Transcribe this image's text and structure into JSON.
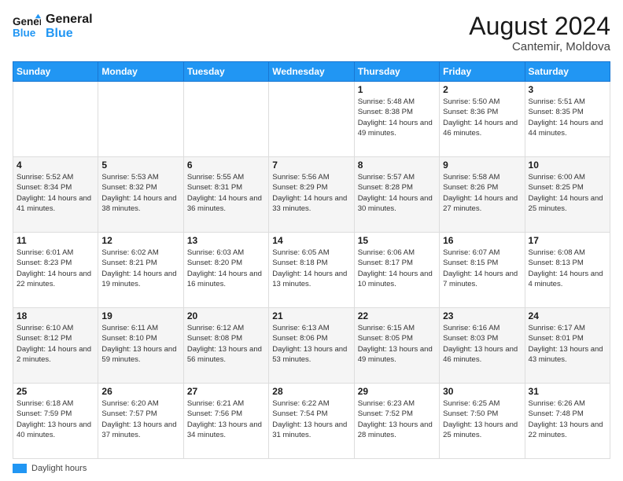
{
  "header": {
    "logo_line1": "General",
    "logo_line2": "Blue",
    "main_title": "August 2024",
    "subtitle": "Cantemir, Moldova"
  },
  "legend": {
    "label": "Daylight hours"
  },
  "days_of_week": [
    "Sunday",
    "Monday",
    "Tuesday",
    "Wednesday",
    "Thursday",
    "Friday",
    "Saturday"
  ],
  "weeks": [
    [
      {
        "day": "",
        "info": ""
      },
      {
        "day": "",
        "info": ""
      },
      {
        "day": "",
        "info": ""
      },
      {
        "day": "",
        "info": ""
      },
      {
        "day": "1",
        "info": "Sunrise: 5:48 AM\nSunset: 8:38 PM\nDaylight: 14 hours\nand 49 minutes."
      },
      {
        "day": "2",
        "info": "Sunrise: 5:50 AM\nSunset: 8:36 PM\nDaylight: 14 hours\nand 46 minutes."
      },
      {
        "day": "3",
        "info": "Sunrise: 5:51 AM\nSunset: 8:35 PM\nDaylight: 14 hours\nand 44 minutes."
      }
    ],
    [
      {
        "day": "4",
        "info": "Sunrise: 5:52 AM\nSunset: 8:34 PM\nDaylight: 14 hours\nand 41 minutes."
      },
      {
        "day": "5",
        "info": "Sunrise: 5:53 AM\nSunset: 8:32 PM\nDaylight: 14 hours\nand 38 minutes."
      },
      {
        "day": "6",
        "info": "Sunrise: 5:55 AM\nSunset: 8:31 PM\nDaylight: 14 hours\nand 36 minutes."
      },
      {
        "day": "7",
        "info": "Sunrise: 5:56 AM\nSunset: 8:29 PM\nDaylight: 14 hours\nand 33 minutes."
      },
      {
        "day": "8",
        "info": "Sunrise: 5:57 AM\nSunset: 8:28 PM\nDaylight: 14 hours\nand 30 minutes."
      },
      {
        "day": "9",
        "info": "Sunrise: 5:58 AM\nSunset: 8:26 PM\nDaylight: 14 hours\nand 27 minutes."
      },
      {
        "day": "10",
        "info": "Sunrise: 6:00 AM\nSunset: 8:25 PM\nDaylight: 14 hours\nand 25 minutes."
      }
    ],
    [
      {
        "day": "11",
        "info": "Sunrise: 6:01 AM\nSunset: 8:23 PM\nDaylight: 14 hours\nand 22 minutes."
      },
      {
        "day": "12",
        "info": "Sunrise: 6:02 AM\nSunset: 8:21 PM\nDaylight: 14 hours\nand 19 minutes."
      },
      {
        "day": "13",
        "info": "Sunrise: 6:03 AM\nSunset: 8:20 PM\nDaylight: 14 hours\nand 16 minutes."
      },
      {
        "day": "14",
        "info": "Sunrise: 6:05 AM\nSunset: 8:18 PM\nDaylight: 14 hours\nand 13 minutes."
      },
      {
        "day": "15",
        "info": "Sunrise: 6:06 AM\nSunset: 8:17 PM\nDaylight: 14 hours\nand 10 minutes."
      },
      {
        "day": "16",
        "info": "Sunrise: 6:07 AM\nSunset: 8:15 PM\nDaylight: 14 hours\nand 7 minutes."
      },
      {
        "day": "17",
        "info": "Sunrise: 6:08 AM\nSunset: 8:13 PM\nDaylight: 14 hours\nand 4 minutes."
      }
    ],
    [
      {
        "day": "18",
        "info": "Sunrise: 6:10 AM\nSunset: 8:12 PM\nDaylight: 14 hours\nand 2 minutes."
      },
      {
        "day": "19",
        "info": "Sunrise: 6:11 AM\nSunset: 8:10 PM\nDaylight: 13 hours\nand 59 minutes."
      },
      {
        "day": "20",
        "info": "Sunrise: 6:12 AM\nSunset: 8:08 PM\nDaylight: 13 hours\nand 56 minutes."
      },
      {
        "day": "21",
        "info": "Sunrise: 6:13 AM\nSunset: 8:06 PM\nDaylight: 13 hours\nand 53 minutes."
      },
      {
        "day": "22",
        "info": "Sunrise: 6:15 AM\nSunset: 8:05 PM\nDaylight: 13 hours\nand 49 minutes."
      },
      {
        "day": "23",
        "info": "Sunrise: 6:16 AM\nSunset: 8:03 PM\nDaylight: 13 hours\nand 46 minutes."
      },
      {
        "day": "24",
        "info": "Sunrise: 6:17 AM\nSunset: 8:01 PM\nDaylight: 13 hours\nand 43 minutes."
      }
    ],
    [
      {
        "day": "25",
        "info": "Sunrise: 6:18 AM\nSunset: 7:59 PM\nDaylight: 13 hours\nand 40 minutes."
      },
      {
        "day": "26",
        "info": "Sunrise: 6:20 AM\nSunset: 7:57 PM\nDaylight: 13 hours\nand 37 minutes."
      },
      {
        "day": "27",
        "info": "Sunrise: 6:21 AM\nSunset: 7:56 PM\nDaylight: 13 hours\nand 34 minutes."
      },
      {
        "day": "28",
        "info": "Sunrise: 6:22 AM\nSunset: 7:54 PM\nDaylight: 13 hours\nand 31 minutes."
      },
      {
        "day": "29",
        "info": "Sunrise: 6:23 AM\nSunset: 7:52 PM\nDaylight: 13 hours\nand 28 minutes."
      },
      {
        "day": "30",
        "info": "Sunrise: 6:25 AM\nSunset: 7:50 PM\nDaylight: 13 hours\nand 25 minutes."
      },
      {
        "day": "31",
        "info": "Sunrise: 6:26 AM\nSunset: 7:48 PM\nDaylight: 13 hours\nand 22 minutes."
      }
    ]
  ]
}
